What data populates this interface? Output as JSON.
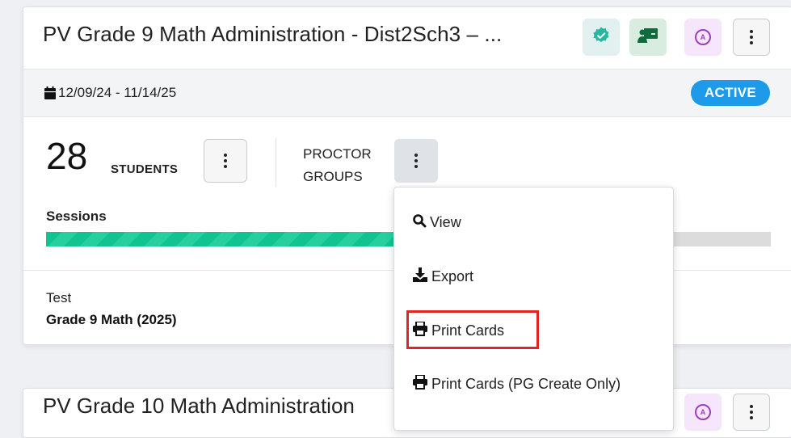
{
  "card1": {
    "title": "PV Grade 9 Math Administration - Dist2Sch3 – ...",
    "date_range": "12/09/24 - 11/14/25",
    "status": "ACTIVE",
    "students_count": "28",
    "students_label": "STUDENTS",
    "proctor_groups_label_line1": "PROCTOR",
    "proctor_groups_label_line2": "GROUPS",
    "sessions_label": "Sessions",
    "sessions_progress_fraction": 0.48,
    "test_label": "Test",
    "test_name": "Grade 9 Math (2025)",
    "header_icons": [
      "verified-check-icon",
      "classroom-icon",
      "accommodation-a-icon",
      "more-vertical-icon"
    ]
  },
  "card2": {
    "title": "PV Grade 10 Math Administration"
  },
  "proctor_menu": {
    "items": [
      {
        "label": "View",
        "icon": "search-icon"
      },
      {
        "label": "Export",
        "icon": "download-icon"
      },
      {
        "label": "Print Cards",
        "icon": "printer-icon"
      },
      {
        "label": "Print Cards (PG Create Only)",
        "icon": "printer-icon"
      }
    ],
    "highlighted_item": "Print Cards"
  },
  "colors": {
    "active_pill": "#1e9be8",
    "progress": "#12c392",
    "highlight_border": "#e02424"
  }
}
